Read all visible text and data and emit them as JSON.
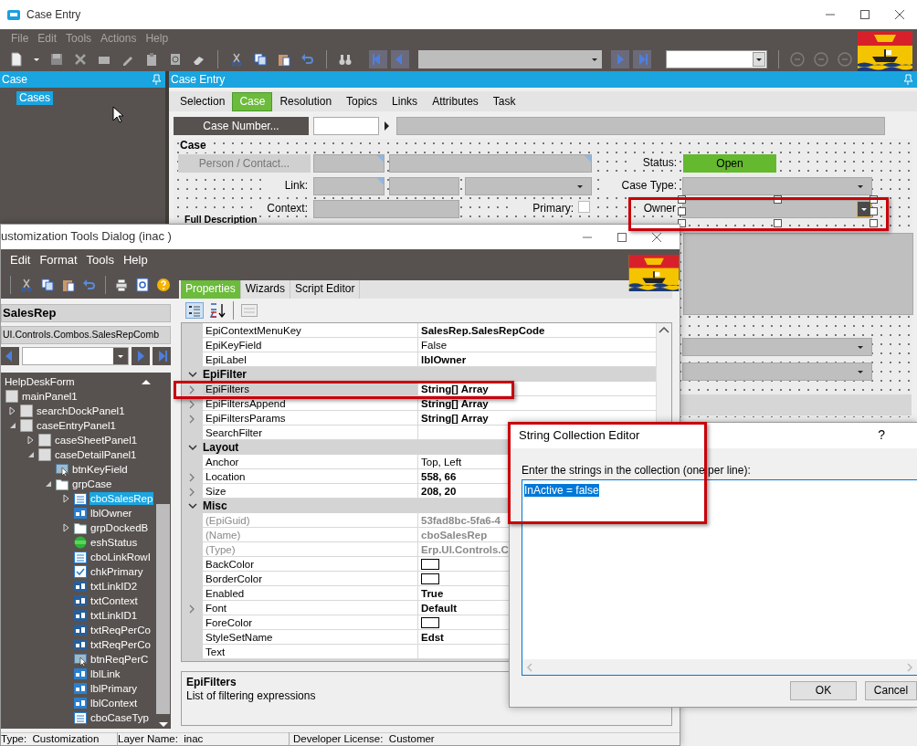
{
  "main_window": {
    "title": "Case Entry",
    "menu": [
      {
        "label": "File",
        "disabled": true
      },
      {
        "label": "Edit",
        "disabled": true
      },
      {
        "label": "Tools",
        "disabled": true
      },
      {
        "label": "Actions",
        "disabled": true
      },
      {
        "label": "Help",
        "disabled": true
      }
    ],
    "left_panel": {
      "title": "Case",
      "items": [
        {
          "label": "Cases",
          "selected": true
        }
      ]
    },
    "content": {
      "title": "Case Entry",
      "tabs": [
        {
          "label": "Selection",
          "selected": false
        },
        {
          "label": "Case",
          "selected": true
        },
        {
          "label": "Resolution",
          "selected": false
        },
        {
          "label": "Topics",
          "selected": false
        },
        {
          "label": "Links",
          "selected": false
        },
        {
          "label": "Attributes",
          "selected": false
        },
        {
          "label": "Task",
          "selected": false
        }
      ],
      "case_number_button": "Case Number...",
      "group": {
        "title": "Case",
        "person_contact_button": "Person / Contact...",
        "status_label": "Status:",
        "status_value": "Open",
        "link_label": "Link:",
        "case_type_label": "Case Type:",
        "context_label": "Context:",
        "primary_label": "Primary:",
        "primary_checked": false,
        "owner_label": "Owner"
      },
      "description_title": "Full Description"
    }
  },
  "customization_dialog": {
    "title": "ustomization Tools Dialog  (inac )",
    "menu": [
      "Edit",
      "Format",
      "Tools",
      "Help"
    ],
    "control_name": "SalesRep",
    "control_type": "UI.Controls.Combos.SalesRepComb",
    "tree": [
      {
        "label": "HelpDeskForm",
        "selected": false,
        "children": [
          {
            "label": "mainPanel1",
            "kind": "panel",
            "selected": false,
            "children": [
              {
                "label": "searchDockPanel1",
                "kind": "panel",
                "expanded": false,
                "selected": false
              },
              {
                "label": "caseEntryPanel1",
                "kind": "panel",
                "expanded": true,
                "selected": false,
                "children": [
                  {
                    "label": "caseSheetPanel1",
                    "kind": "panel",
                    "expanded": false,
                    "selected": false
                  },
                  {
                    "label": "caseDetailPanel1",
                    "kind": "panel",
                    "expanded": true,
                    "selected": false,
                    "children": [
                      {
                        "label": "btnKeyField",
                        "kind": "button",
                        "selected": false
                      },
                      {
                        "label": "grpCase",
                        "kind": "group",
                        "expanded": true,
                        "selected": false,
                        "children": [
                          {
                            "label": "cboSalesRep",
                            "kind": "combo",
                            "expanded": false,
                            "selected": true
                          },
                          {
                            "label": "lblOwner",
                            "kind": "label",
                            "selected": false
                          },
                          {
                            "label": "grpDockedB",
                            "kind": "group",
                            "expanded": false,
                            "selected": false
                          },
                          {
                            "label": "eshStatus",
                            "kind": "status",
                            "selected": false
                          },
                          {
                            "label": "cboLinkRowI",
                            "kind": "combo",
                            "selected": false
                          },
                          {
                            "label": "chkPrimary",
                            "kind": "check",
                            "selected": false
                          },
                          {
                            "label": "txtLinkID2",
                            "kind": "text",
                            "selected": false
                          },
                          {
                            "label": "txtContext",
                            "kind": "text",
                            "selected": false
                          },
                          {
                            "label": "txtLinkID1",
                            "kind": "text",
                            "selected": false
                          },
                          {
                            "label": "txtReqPerCo",
                            "kind": "text",
                            "selected": false
                          },
                          {
                            "label": "txtReqPerCo",
                            "kind": "text",
                            "selected": false
                          },
                          {
                            "label": "btnReqPerC",
                            "kind": "button",
                            "selected": false
                          },
                          {
                            "label": "lblLink",
                            "kind": "label",
                            "selected": false
                          },
                          {
                            "label": "lblPrimary",
                            "kind": "label",
                            "selected": false
                          },
                          {
                            "label": "lblContext",
                            "kind": "label",
                            "selected": false
                          },
                          {
                            "label": "cboCaseTyp",
                            "kind": "combo",
                            "selected": false
                          }
                        ]
                      }
                    ]
                  }
                ]
              }
            ]
          }
        ]
      }
    ],
    "tabs": [
      {
        "label": "Properties",
        "selected": true
      },
      {
        "label": "Wizards",
        "selected": false
      },
      {
        "label": "Script Editor",
        "selected": false
      }
    ],
    "property_groups": [
      {
        "rows": [
          {
            "name": "EpiContextMenuKey",
            "value": "SalesRep.SalesRepCode",
            "kind": "text",
            "bold": true,
            "expandable": false,
            "disabled": false,
            "selected": false
          },
          {
            "name": "EpiKeyField",
            "value": "False",
            "kind": "text",
            "bold": false,
            "expandable": false,
            "disabled": false,
            "selected": false
          },
          {
            "name": "EpiLabel",
            "value": "lblOwner",
            "kind": "text",
            "bold": true,
            "expandable": false,
            "disabled": false,
            "selected": false
          }
        ]
      },
      {
        "title": "EpiFilter",
        "expanded": true,
        "rows": [
          {
            "name": "EpiFilters",
            "value": "String[] Array",
            "kind": "text",
            "bold": true,
            "expandable": true,
            "disabled": false,
            "selected": true
          },
          {
            "name": "EpiFiltersAppend",
            "value": "String[] Array",
            "kind": "text",
            "bold": true,
            "expandable": true,
            "disabled": false,
            "selected": false
          },
          {
            "name": "EpiFiltersParams",
            "value": "String[] Array",
            "kind": "text",
            "bold": true,
            "expandable": true,
            "disabled": false,
            "selected": false
          },
          {
            "name": "SearchFilter",
            "kind": "text",
            "expandable": false,
            "disabled": false,
            "selected": false
          }
        ]
      },
      {
        "title": "Layout",
        "expanded": true,
        "rows": [
          {
            "name": "Anchor",
            "value": "Top, Left",
            "kind": "text",
            "bold": false,
            "expandable": false,
            "disabled": false,
            "selected": false
          },
          {
            "name": "Location",
            "value": "558, 66",
            "kind": "text",
            "bold": true,
            "expandable": true,
            "disabled": false,
            "selected": false
          },
          {
            "name": "Size",
            "value": "208, 20",
            "kind": "text",
            "bold": true,
            "expandable": true,
            "disabled": false,
            "selected": false
          }
        ]
      },
      {
        "title": "Misc",
        "expanded": true,
        "rows": [
          {
            "name": "(EpiGuid)",
            "value": "53fad8bc-5fa6-4",
            "kind": "text",
            "bold": true,
            "expandable": false,
            "disabled": true,
            "selected": false
          },
          {
            "name": "(Name)",
            "value": "cboSalesRep",
            "kind": "text",
            "bold": true,
            "expandable": false,
            "disabled": true,
            "selected": false
          },
          {
            "name": "(Type)",
            "value": "Erp.UI.Controls.C",
            "kind": "text",
            "bold": true,
            "expandable": false,
            "disabled": true,
            "selected": false
          },
          {
            "name": "BackColor",
            "kind": "color",
            "color": "#ffffff",
            "expandable": false,
            "disabled": false,
            "selected": false
          },
          {
            "name": "BorderColor",
            "kind": "color",
            "color": "#ffffff",
            "expandable": false,
            "disabled": false,
            "selected": false
          },
          {
            "name": "Enabled",
            "value": "True",
            "kind": "text",
            "bold": true,
            "expandable": false,
            "disabled": false,
            "selected": false
          },
          {
            "name": "Font",
            "value": "Default",
            "kind": "text",
            "bold": true,
            "expandable": true,
            "disabled": false,
            "selected": false
          },
          {
            "name": "ForeColor",
            "kind": "color",
            "color": "#ffffff",
            "expandable": false,
            "disabled": false,
            "selected": false
          },
          {
            "name": "StyleSetName",
            "value": "Edst",
            "kind": "text",
            "bold": true,
            "expandable": false,
            "disabled": false,
            "selected": false
          },
          {
            "name": "Text",
            "kind": "text",
            "expandable": false,
            "disabled": false,
            "selected": false
          }
        ]
      }
    ],
    "description": {
      "title": "EpiFilters",
      "text": "List of filtering expressions"
    },
    "status_bar": [
      "Type:  Customization",
      "Layer Name:  inac",
      "Developer License:  Customer"
    ]
  },
  "string_editor": {
    "title": "String Collection Editor",
    "help": "?",
    "prompt": "Enter the strings in the collection (one per line):",
    "lines": [
      {
        "text": "InActive = false",
        "selected": true
      }
    ],
    "buttons": [
      "OK",
      "Cancel"
    ]
  }
}
